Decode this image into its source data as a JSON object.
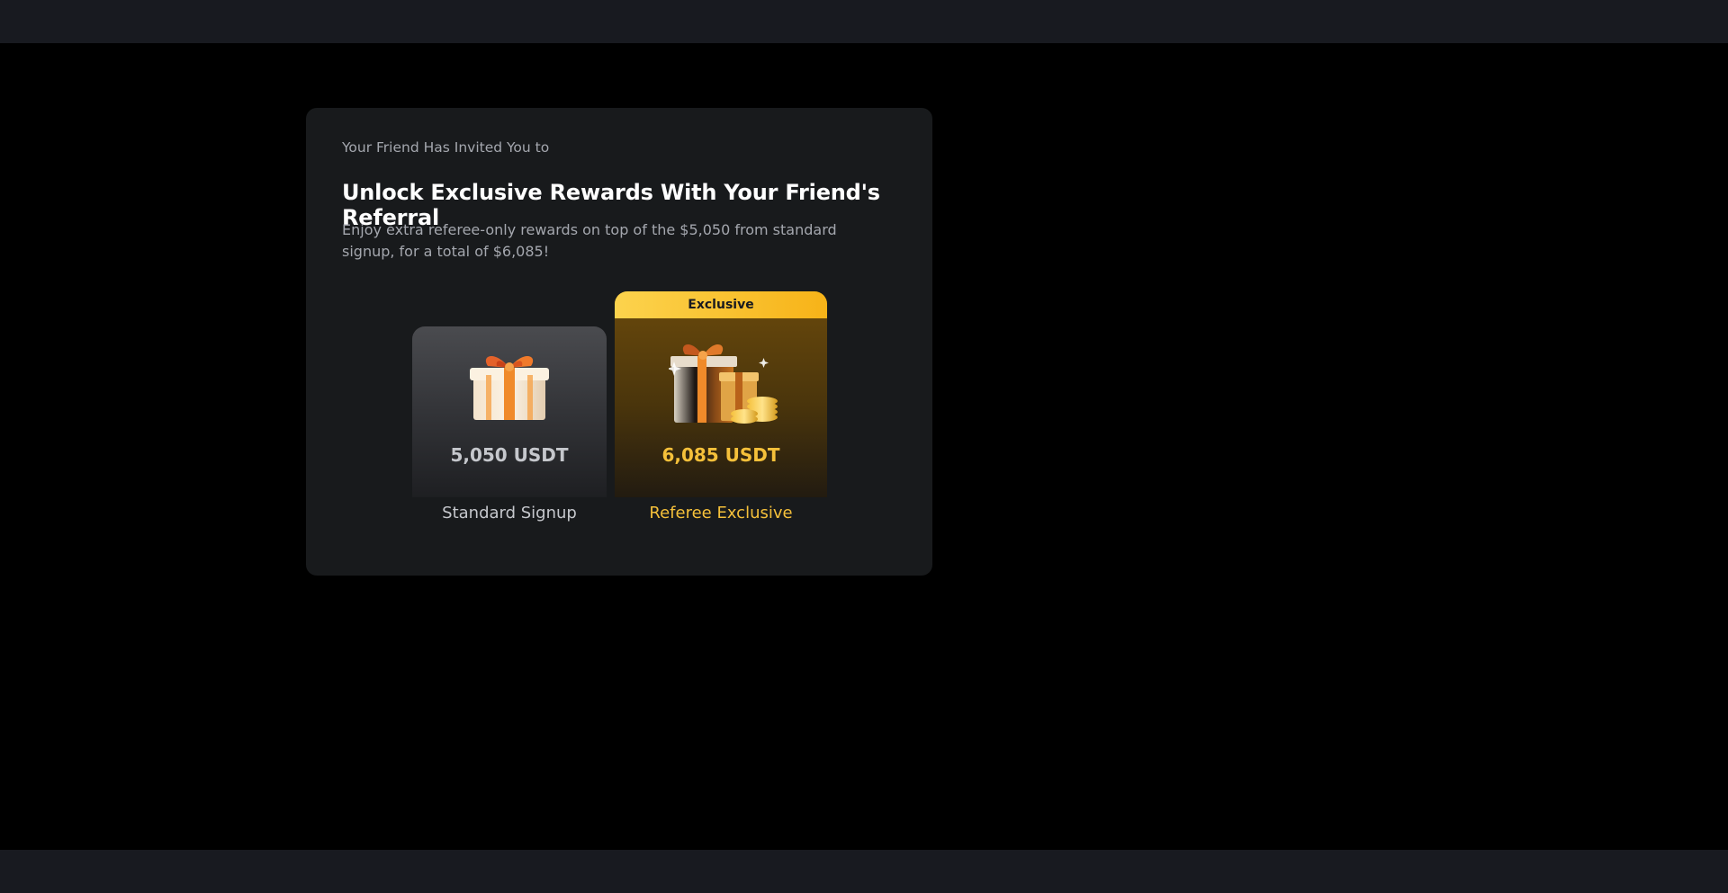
{
  "invite": {
    "eyebrow": "Your Friend Has Invited You to",
    "headline": "Unlock Exclusive Rewards With Your Friend's Referral",
    "description": "Enjoy extra referee-only rewards on top of the $5,050 from standard signup, for a total of $6,085!"
  },
  "rewards": {
    "standard": {
      "amount": "5,050 USDT",
      "label": "Standard Signup",
      "icon": "gift-box-icon"
    },
    "exclusive": {
      "badge": "Exclusive",
      "amount": "6,085 USDT",
      "label": "Referee Exclusive",
      "icon": "gift-boxes-with-coins-icon"
    }
  },
  "colors": {
    "page_background": "#000000",
    "bar_background": "#181a20",
    "card_background": "#181a1c",
    "accent_gold": "#f5c03a",
    "badge_gold": "#fcd34d",
    "text_muted": "#a4a7ae"
  }
}
